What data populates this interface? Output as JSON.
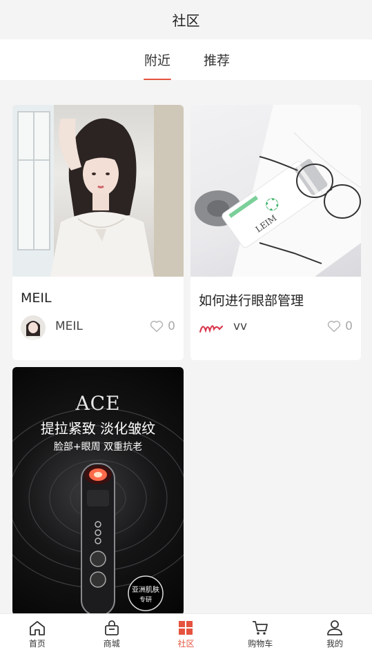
{
  "header": {
    "title": "社区"
  },
  "tabs": [
    {
      "label": "附近",
      "active": true
    },
    {
      "label": "推荐",
      "active": false
    }
  ],
  "posts": [
    {
      "title": "MEIL",
      "author": "MEIL",
      "likes": "0"
    },
    {
      "title": "如何进行眼部管理",
      "author": "vv",
      "likes": "0",
      "image_text": {
        "tube": "LEIM"
      }
    },
    {
      "image_text": {
        "brand": "ACE",
        "headline": "提拉紧致 淡化皱纹",
        "subline": "脸部+眼周 双重抗老",
        "badge_line1": "亚洲肌肤",
        "badge_line2": "专研"
      }
    }
  ],
  "bottom_nav": [
    {
      "label": "首页",
      "icon": "home-icon"
    },
    {
      "label": "商城",
      "icon": "shopping-bag-icon"
    },
    {
      "label": "社区",
      "icon": "community-grid-icon",
      "active": true
    },
    {
      "label": "购物车",
      "icon": "cart-icon"
    },
    {
      "label": "我的",
      "icon": "user-icon"
    }
  ],
  "colors": {
    "accent": "#e5533f",
    "background": "#f4f4f4"
  }
}
